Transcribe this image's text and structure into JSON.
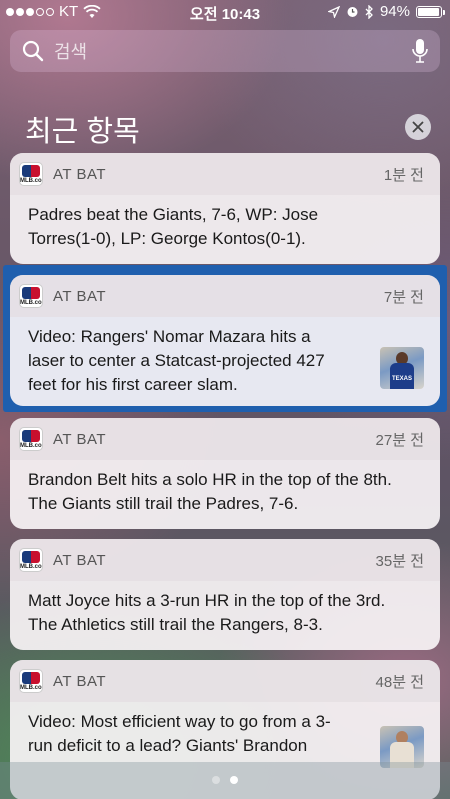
{
  "status_bar": {
    "carrier": "KT",
    "time": "오전 10:43",
    "battery": "94%",
    "battery_level": 0.94,
    "signal_bars": 3
  },
  "search": {
    "placeholder": "검색",
    "icon": "search-icon",
    "mic_icon": "microphone-icon"
  },
  "section": {
    "title": "최근 항목",
    "clear_icon": "close-icon"
  },
  "notifications": [
    {
      "app": "AT BAT",
      "time": "1분 전",
      "lines": [
        "Padres beat the Giants, 7-6, WP: Jose",
        "Torres(1-0), LP: George Kontos(0-1)."
      ],
      "has_thumbnail": false
    },
    {
      "app": "AT BAT",
      "time": "7분 전",
      "lines": [
        "Video: Rangers' Nomar Mazara hits a",
        "laser to center a Statcast-projected 427",
        "feet for his first career slam."
      ],
      "has_thumbnail": true,
      "thumbnail_text": "TEXAS"
    },
    {
      "app": "AT BAT",
      "time": "27분 전",
      "lines": [
        "Brandon Belt hits a solo HR in the top of the 8th.",
        "The Giants still trail the Padres, 7-6."
      ],
      "has_thumbnail": false
    },
    {
      "app": "AT BAT",
      "time": "35분 전",
      "lines": [
        "Matt Joyce hits a 3-run HR in the top of the 3rd.",
        "The Athletics still trail the Rangers, 8-3."
      ],
      "has_thumbnail": false
    },
    {
      "app": "AT BAT",
      "time": "48분 전",
      "lines": [
        "Video: Most efficient way to go from a 3-",
        "run deficit to a lead? Giants' Brandon"
      ],
      "has_thumbnail": true
    }
  ],
  "app_icon_label": "MLB.com",
  "colors": {
    "highlight": "#1f5fae"
  },
  "pagination": {
    "count": 2,
    "active": 1
  }
}
